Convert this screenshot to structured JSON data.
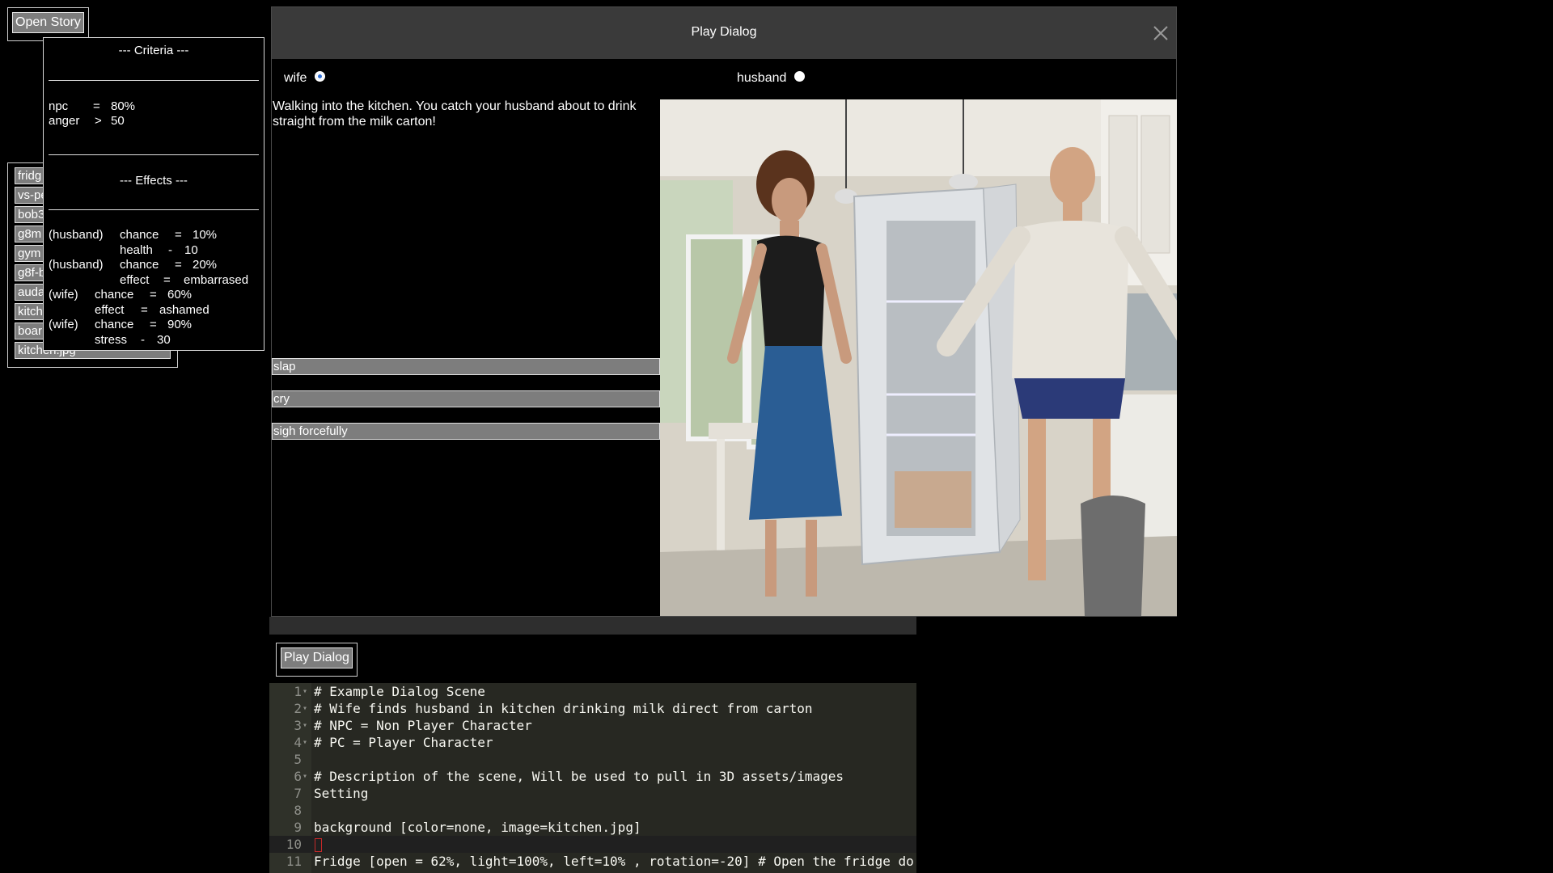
{
  "toolbar": {
    "open_story_label": "Open Story"
  },
  "file_list": {
    "items": [
      "fridg",
      "vs-pe",
      "bob3",
      "g8m",
      "gym",
      "g8f-b",
      "auda",
      "kitch",
      "boar",
      "kitchen.jpg"
    ]
  },
  "criteria_panel": {
    "criteria_heading": "--- Criteria ---",
    "criteria": [
      {
        "name": "npc",
        "op": "=",
        "value": "80%"
      },
      {
        "name": "anger",
        "op": ">",
        "value": "50"
      }
    ],
    "effects_heading": "--- Effects ---",
    "effects": [
      {
        "target": "(husband)",
        "name": "chance",
        "op": "=",
        "value": "10%"
      },
      {
        "target": "",
        "name": "health",
        "op": "-",
        "value": "10"
      },
      {
        "target": "(husband)",
        "name": "chance",
        "op": "=",
        "value": "20%"
      },
      {
        "target": "",
        "name": "effect",
        "op": "=",
        "value": "embarrased"
      },
      {
        "target": "(wife)",
        "name": "chance",
        "op": "=",
        "value": "60%"
      },
      {
        "target": "",
        "name": "effect",
        "op": "=",
        "value": "ashamed"
      },
      {
        "target": "(wife)",
        "name": "chance",
        "op": "=",
        "value": "90%"
      },
      {
        "target": "",
        "name": "stress",
        "op": "-",
        "value": "30"
      }
    ]
  },
  "modal": {
    "title": "Play Dialog",
    "roles": [
      {
        "label": "wife",
        "selected": true
      },
      {
        "label": "husband",
        "selected": false
      }
    ],
    "dialog_text": "Walking into the kitchen. You catch your husband about to drink straight from the milk carton!",
    "choices": [
      "slap",
      "cry",
      "sigh forcefully"
    ]
  },
  "editor": {
    "play_button_label": "Play Dialog",
    "lines": [
      {
        "n": "1",
        "fold": true,
        "text": "# Example Dialog Scene"
      },
      {
        "n": "2",
        "fold": true,
        "text": "# Wife finds husband in kitchen drinking milk direct from carton"
      },
      {
        "n": "3",
        "fold": true,
        "text": "# NPC = Non Player Character"
      },
      {
        "n": "4",
        "fold": true,
        "text": "# PC = Player Character"
      },
      {
        "n": "5",
        "fold": false,
        "text": ""
      },
      {
        "n": "6",
        "fold": true,
        "text": "# Description of the scene, Will be used to pull in 3D assets/images"
      },
      {
        "n": "7",
        "fold": false,
        "text": "Setting"
      },
      {
        "n": "8",
        "fold": false,
        "text": ""
      },
      {
        "n": "9",
        "fold": false,
        "text": "background [color=none, image=kitchen.jpg]"
      },
      {
        "n": "10",
        "fold": false,
        "text": ""
      },
      {
        "n": "11",
        "fold": false,
        "text": "Fridge [open = 62%, light=100%, left=10% , rotation=-20] # Open the fridge do"
      }
    ]
  },
  "colors": {
    "panel_bg": "#000000",
    "title_bar": "#3a3a3a",
    "button_gray": "#7d7d7d",
    "radio_selected": "#2f6fd6",
    "editor_bg": "#272822",
    "editor_gutter": "#2f3129"
  }
}
